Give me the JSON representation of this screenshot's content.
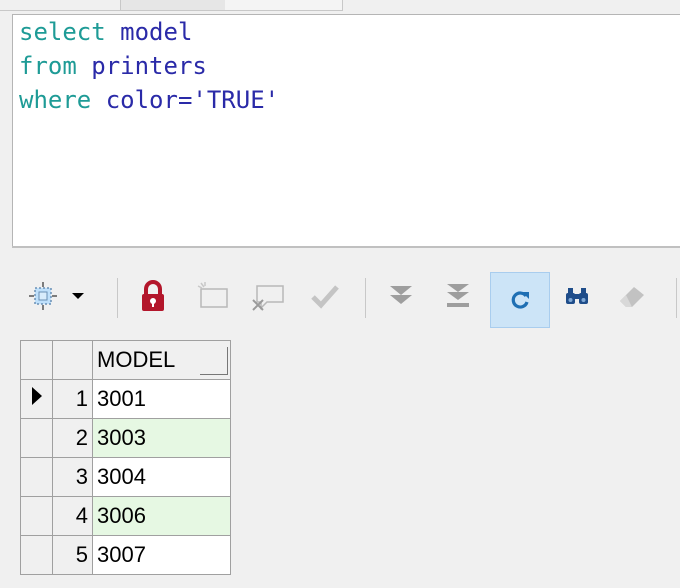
{
  "editor": {
    "lines": [
      {
        "kw": "select",
        "rest": " model"
      },
      {
        "kw": "from",
        "rest": " printers"
      },
      {
        "kw": "where",
        "rest": " color='TRUE'"
      }
    ]
  },
  "toolbar": {
    "icons": [
      "grid-select-icon",
      "dropdown-arrow-icon",
      "lock-icon",
      "insert-record-icon",
      "delete-record-icon",
      "post-edit-icon",
      "next-page-icon",
      "last-page-icon",
      "refresh-icon",
      "find-icon",
      "clear-icon"
    ],
    "colors": {
      "lock": "#b3162b",
      "active_bg": "#cce4f7",
      "refresh": "#1f6fb3",
      "find": "#1f4d8a"
    }
  },
  "grid": {
    "column_header": "MODEL",
    "current_row_indicator": "▶",
    "rows": [
      {
        "num": "1",
        "model": "3001"
      },
      {
        "num": "2",
        "model": "3003"
      },
      {
        "num": "3",
        "model": "3004"
      },
      {
        "num": "4",
        "model": "3006"
      },
      {
        "num": "5",
        "model": "3007"
      }
    ],
    "alt_row_color": "#e6f8e3"
  }
}
